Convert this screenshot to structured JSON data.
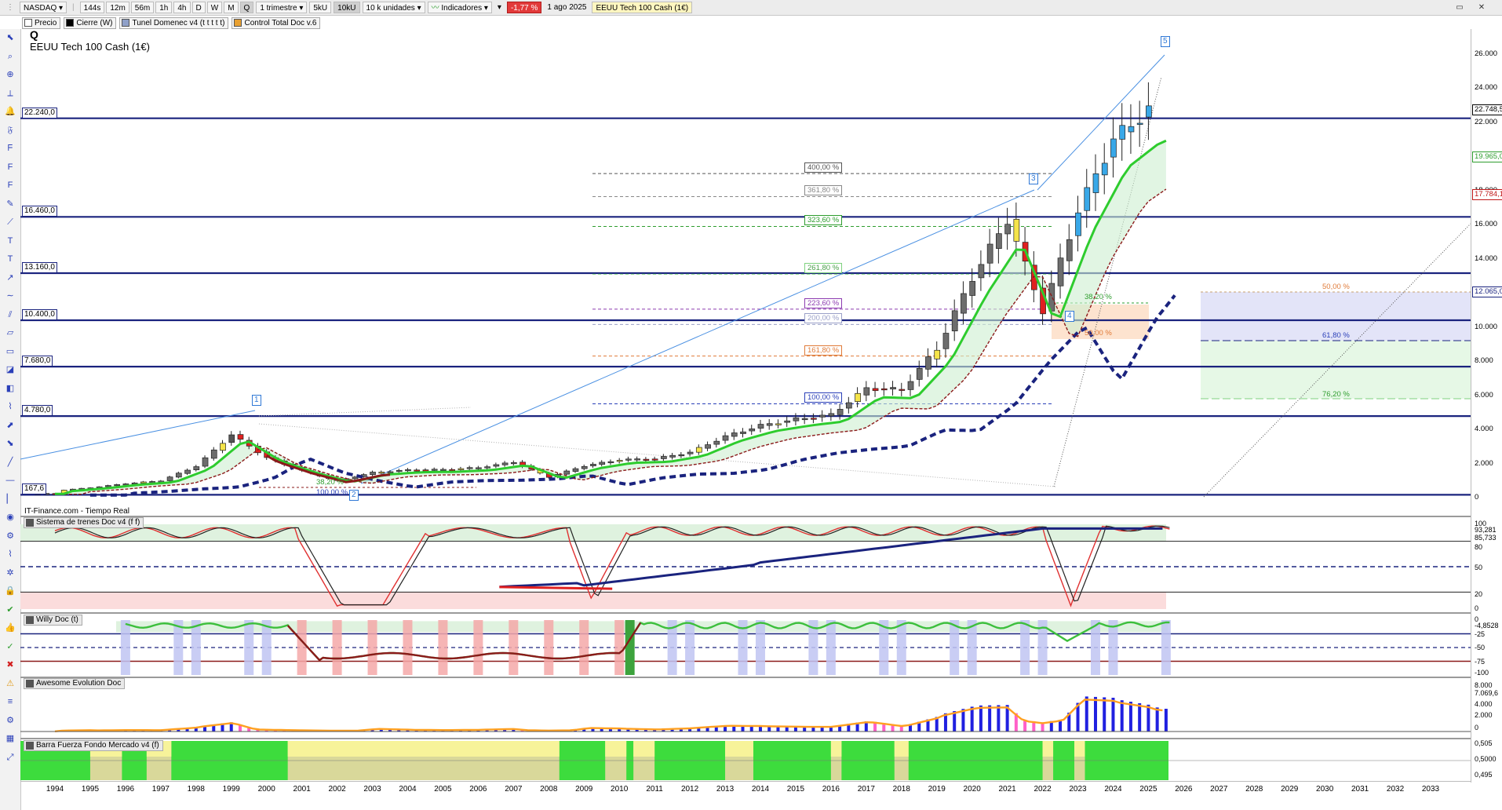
{
  "toolbar": {
    "symbol": "NASDAQ",
    "intervals": [
      "144s",
      "12m",
      "56m",
      "1h",
      "4h",
      "D",
      "W",
      "M",
      "Q"
    ],
    "selected_interval": "Q",
    "period": "1 trimestre",
    "units": [
      "5kU",
      "10kU"
    ],
    "selected_unit": "10kU",
    "volume_units": "10 k unidades",
    "indicators": "Indicadores",
    "change": "-1,77 %",
    "date": "1 ago 2025",
    "instrument": "EEUU Tech 100 Cash (1€)"
  },
  "legend_chips": [
    {
      "label": "Precio",
      "color": "#ffffff"
    },
    {
      "label": "Cierre (W)",
      "color": "#000000"
    },
    {
      "label": "Tunel Domenec v4 (t t t t t)",
      "color": "#8fa0c8"
    },
    {
      "label": "Control Total Doc v.6",
      "color": "#e8a030"
    }
  ],
  "main": {
    "title": "Q",
    "subtitle": "EEUU Tech 100 Cash (1€)",
    "source": "IT-Finance.com - Tiempo Real"
  },
  "panels": {
    "trenes": "Sistema de trenes Doc v4 (f f)",
    "willy": "Willy Doc (t)",
    "awesome": "Awesome Evolution Doc",
    "barra": "Barra Fuerza Fondo Mercado v4 (f)"
  },
  "horizontal_levels": [
    {
      "label": "22.240,0",
      "value": 22240
    },
    {
      "label": "16.460,0",
      "value": 16460
    },
    {
      "label": "13.160,0",
      "value": 13160
    },
    {
      "label": "10.400,0",
      "value": 10400
    },
    {
      "label": "7.680,0",
      "value": 7680
    },
    {
      "label": "4.780,0",
      "value": 4780
    },
    {
      "label": "167,6",
      "value": 167.6
    }
  ],
  "fib_extension_labels": [
    {
      "label": "400,00 %",
      "value": 19000,
      "color": "#555555"
    },
    {
      "label": "361,80 %",
      "value": 17650,
      "color": "#888888"
    },
    {
      "label": "323,60 %",
      "value": 15900,
      "color": "#2e9d2e"
    },
    {
      "label": "261,80 %",
      "value": 13100,
      "color": "#7fd27f"
    },
    {
      "label": "223,60 %",
      "value": 11050,
      "color": "#8c3bb0"
    },
    {
      "label": "200,00 %",
      "value": 10150,
      "color": "#9aa0c8"
    },
    {
      "label": "161,80 %",
      "value": 8300,
      "color": "#e07b39"
    },
    {
      "label": "100,00 %",
      "value": 5500,
      "color": "#2a3fb8"
    }
  ],
  "retracement_labels": [
    {
      "label": "38,20 %",
      "color": "#2e9d2e"
    },
    {
      "label": "50,00 %",
      "color": "#e07b39"
    },
    {
      "label": "100,00 %",
      "color": "#2a3fb8"
    },
    {
      "label": "38,20 %",
      "color": "#2e9d2e"
    }
  ],
  "zone_labels": [
    {
      "label": "50,00 %",
      "color": "#e07b39"
    },
    {
      "label": "61,80 %",
      "color": "#2a3fb8"
    },
    {
      "label": "76,20 %",
      "color": "#2e9d2e"
    }
  ],
  "wave_labels": [
    "1",
    "2",
    "3",
    "4",
    "5"
  ],
  "price_axis": {
    "ticks": [
      "26.000",
      "24.000",
      "22.000",
      "19.965,0",
      "18.000",
      "16.000",
      "14.000",
      "12.065,0",
      "10.000",
      "8.000",
      "6.000",
      "4.000",
      "2.000",
      "0"
    ],
    "current": "22.748,5",
    "label_green": "19.965,0",
    "label_red": "17.784,1",
    "label_blue": "12.065,0"
  },
  "trenes_axis": [
    "100",
    "93,281",
    "85,733",
    "80",
    "50",
    "20",
    "0"
  ],
  "willy_axis": [
    "0",
    "-4,8528",
    "-25",
    "-50",
    "-75",
    "-100"
  ],
  "awesome_axis": [
    "8.000",
    "7.069,6",
    "4.000",
    "2.000",
    "0"
  ],
  "barra_axis": [
    "0,505",
    "0,5000",
    "0,495"
  ],
  "years": [
    "1994",
    "1995",
    "1996",
    "1997",
    "1998",
    "1999",
    "2000",
    "2001",
    "2002",
    "2003",
    "2004",
    "2005",
    "2006",
    "2007",
    "2008",
    "2009",
    "2010",
    "2011",
    "2012",
    "2013",
    "2014",
    "2015",
    "2016",
    "2017",
    "2018",
    "2019",
    "2020",
    "2021",
    "2022",
    "2023",
    "2024",
    "2025",
    "2026",
    "2027",
    "2028",
    "2029",
    "2030",
    "2031",
    "2032",
    "2033"
  ],
  "chart_data": {
    "type": "candlestick",
    "title": "EEUU Tech 100 Cash (1€)",
    "interval": "Q",
    "x": [
      "1994",
      "1995",
      "1996",
      "1997",
      "1998",
      "1999",
      "2000",
      "2001",
      "2002",
      "2003",
      "2004",
      "2005",
      "2006",
      "2007",
      "2008",
      "2009",
      "2010",
      "2011",
      "2012",
      "2013",
      "2014",
      "2015",
      "2016",
      "2017",
      "2018",
      "2019",
      "2020",
      "2021",
      "2022",
      "2023",
      "2024",
      "2025"
    ],
    "close": [
      404,
      580,
      820,
      990,
      1840,
      3700,
      2340,
      1580,
      985,
      1470,
      1620,
      1645,
      1760,
      2080,
      1210,
      1860,
      2220,
      2280,
      2660,
      3590,
      4230,
      4590,
      4860,
      6400,
      6330,
      8730,
      12890,
      16320,
      10940,
      16830,
      21010,
      22748
    ],
    "ylim": [
      0,
      26500
    ],
    "levels": [
      22240,
      16460,
      13160,
      10400,
      7680,
      4780,
      167.6
    ]
  }
}
